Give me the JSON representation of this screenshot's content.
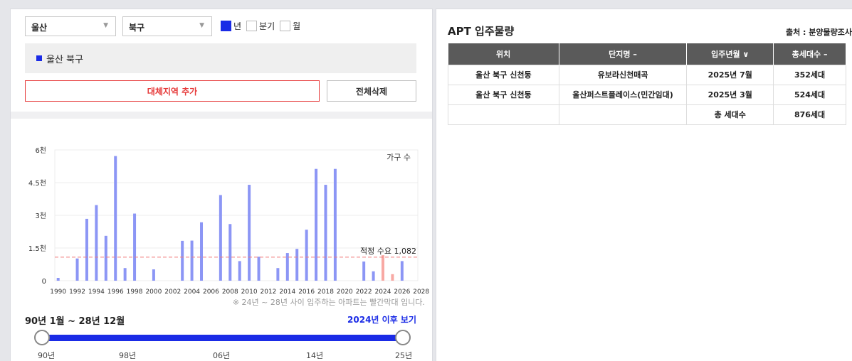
{
  "filters": {
    "city": "울산",
    "district": "북구",
    "period_options": [
      {
        "label": "년",
        "checked": true
      },
      {
        "label": "분기",
        "checked": false
      },
      {
        "label": "월",
        "checked": false
      }
    ]
  },
  "region_list": [
    "울산 북구"
  ],
  "buttons": {
    "add_region": "대체지역 추가",
    "delete_all": "전체삭제"
  },
  "chart_data": {
    "type": "bar",
    "legend_label": "가구 수",
    "y_ticks": [
      "0",
      "1.5천",
      "3천",
      "4.5천",
      "6천"
    ],
    "ylim": [
      0,
      6000
    ],
    "x": [
      1990,
      1991,
      1992,
      1993,
      1994,
      1995,
      1996,
      1997,
      1998,
      1999,
      2000,
      2001,
      2002,
      2003,
      2004,
      2005,
      2006,
      2007,
      2008,
      2009,
      2010,
      2011,
      2012,
      2013,
      2014,
      2015,
      2016,
      2017,
      2018,
      2019,
      2020,
      2021,
      2022,
      2023,
      2024,
      2025,
      2026,
      2027,
      2028
    ],
    "values": [
      130,
      0,
      1020,
      2840,
      3470,
      2060,
      5720,
      580,
      3080,
      0,
      520,
      0,
      0,
      1830,
      1840,
      2680,
      0,
      3930,
      2600,
      900,
      4400,
      1100,
      0,
      580,
      1270,
      1460,
      2340,
      5130,
      4400,
      5130,
      0,
      0,
      880,
      430,
      1170,
      300,
      900,
      0,
      0
    ],
    "highlight_years": [
      2024,
      2025
    ],
    "x_tick_labels": [
      "1990",
      "1992",
      "1994",
      "1996",
      "1998",
      "2000",
      "2002",
      "2004",
      "2006",
      "2008",
      "2010",
      "2012",
      "2014",
      "2016",
      "2018",
      "2020",
      "2022",
      "2024",
      "2026",
      "2028"
    ],
    "reference": {
      "label": "적정 수요 1,082",
      "value": 1082
    },
    "colors": {
      "bar": "#8c96f5",
      "highlight": "#f8a9a4",
      "reference": "#f07a7a"
    }
  },
  "note": "※ 24년 ~ 28년 사이 입주하는 아파트는 빨간막대 입니다.",
  "range": {
    "label": "90년 1월 ~ 28년 12월",
    "after_link": "2024년 이후 보기",
    "labels": [
      "90년",
      "98년",
      "06년",
      "14년",
      "25년"
    ]
  },
  "panel": {
    "title": "APT 입주물량",
    "source": "출처 : 분양물량조사",
    "columns": [
      "위치",
      "단지명 –",
      "입주년월 ∨",
      "총세대수 –"
    ],
    "rows": [
      [
        "울산 북구 신천동",
        "유보라신천매곡",
        "2025년 7월",
        "352세대"
      ],
      [
        "울산 북구 신천동",
        "울산퍼스트플레이스(민간임대)",
        "2025년 3월",
        "524세대"
      ]
    ],
    "total": {
      "label": "총 세대수",
      "value": "876세대"
    }
  }
}
